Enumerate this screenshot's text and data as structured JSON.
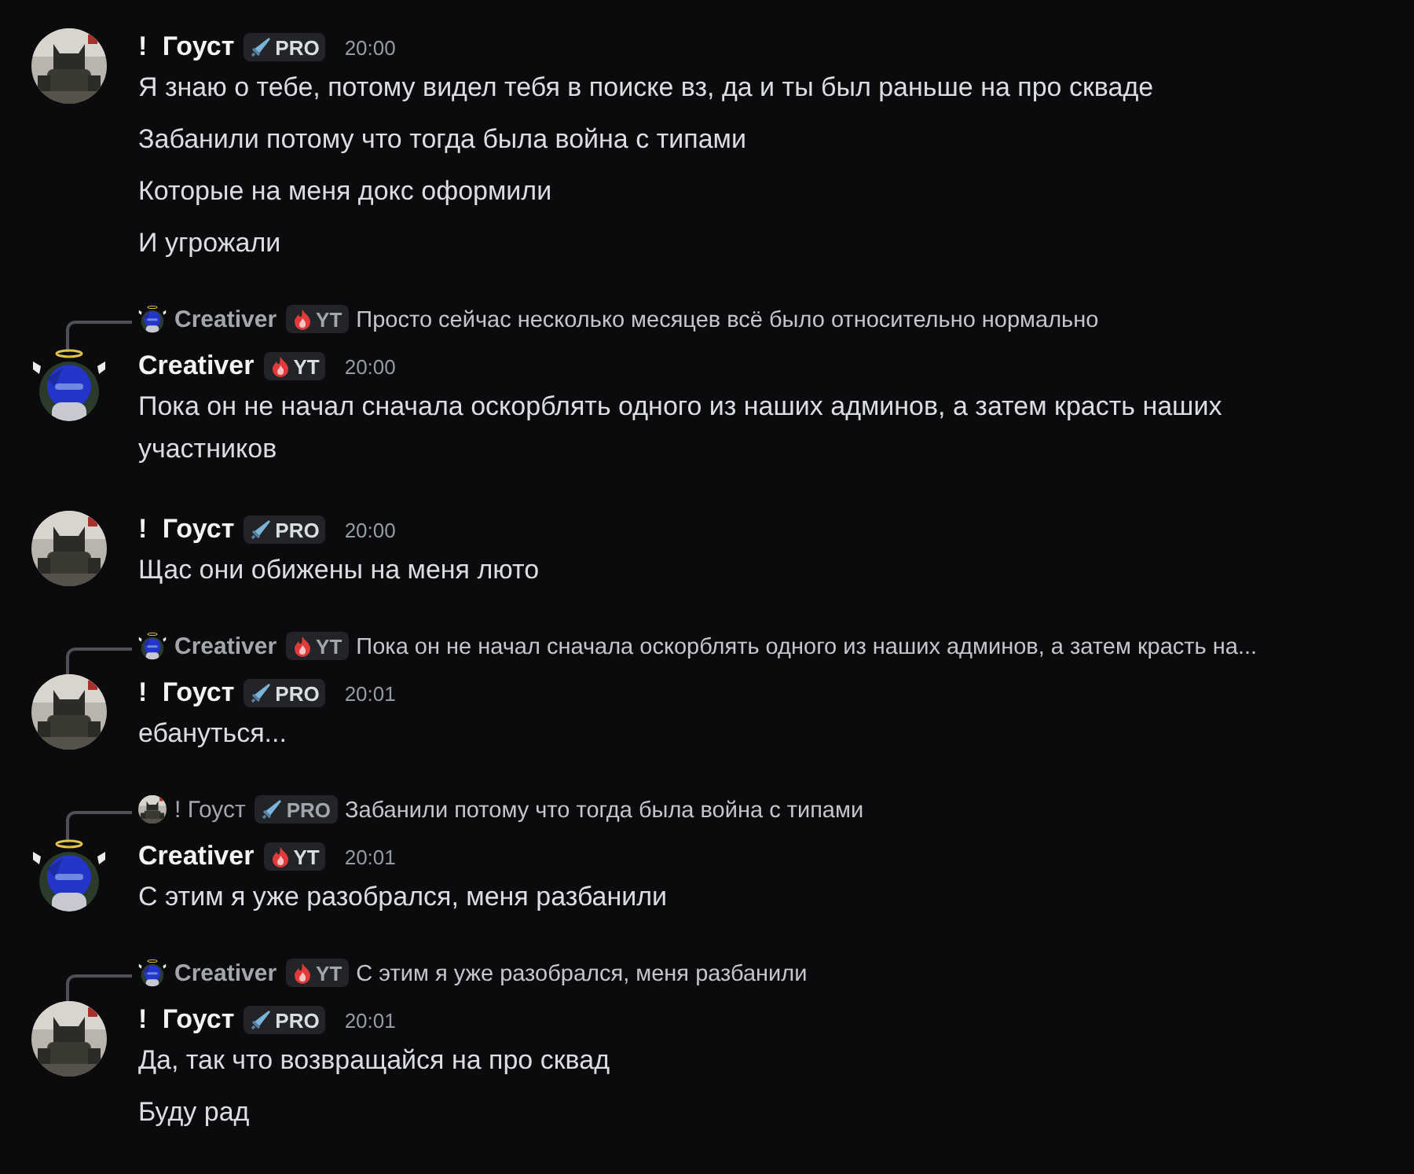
{
  "messages": [
    {
      "author": "! Гоуст",
      "avatar": {
        "kind": "dark"
      },
      "badge": {
        "kind": "sword",
        "label": "PRO"
      },
      "time": "20:00",
      "lines": [
        "Я знаю о тебе, потому видел тебя в поиске вз, да и ты был раньше на про скваде",
        "Забанили потому что тогда была война с типами",
        "Которые на меня докс оформили",
        "И угрожали"
      ]
    },
    {
      "reply": {
        "author": "Creativer",
        "avatar": {
          "kind": "blue"
        },
        "badge": {
          "kind": "flame",
          "label": "YT"
        },
        "text": "Просто сейчас несколько месяцев всё было относительно нормально"
      },
      "author": "Creativer",
      "avatar": {
        "kind": "blue"
      },
      "badge": {
        "kind": "flame",
        "label": "YT"
      },
      "time": "20:00",
      "lines": [
        "Пока он не начал сначала оскорблять одного из наших админов, а затем красть наших участников"
      ]
    },
    {
      "author": "! Гоуст",
      "avatar": {
        "kind": "dark"
      },
      "badge": {
        "kind": "sword",
        "label": "PRO"
      },
      "time": "20:00",
      "lines": [
        "Щас они обижены на меня люто"
      ]
    },
    {
      "reply": {
        "author": "Creativer",
        "avatar": {
          "kind": "blue"
        },
        "badge": {
          "kind": "flame",
          "label": "YT"
        },
        "text": "Пока он не начал сначала оскорблять одного из наших админов, а затем красть на..."
      },
      "author": "! Гоуст",
      "avatar": {
        "kind": "dark"
      },
      "badge": {
        "kind": "sword",
        "label": "PRO"
      },
      "time": "20:01",
      "lines": [
        "ебануться..."
      ]
    },
    {
      "reply": {
        "author": "! Гоуст",
        "avatar": {
          "kind": "dark"
        },
        "badge": {
          "kind": "sword",
          "label": "PRO"
        },
        "text": "Забанили потому что тогда была война с типами"
      },
      "author": "Creativer",
      "avatar": {
        "kind": "blue"
      },
      "badge": {
        "kind": "flame",
        "label": "YT"
      },
      "time": "20:01",
      "lines": [
        "С этим я уже разобрался, меня разбанили"
      ]
    },
    {
      "reply": {
        "author": "Creativer",
        "avatar": {
          "kind": "blue"
        },
        "badge": {
          "kind": "flame",
          "label": "YT"
        },
        "text": "С этим я уже разобрался, меня разбанили"
      },
      "author": "! Гоуст",
      "avatar": {
        "kind": "dark"
      },
      "badge": {
        "kind": "sword",
        "label": "PRO"
      },
      "time": "20:01",
      "lines": [
        "Да, так что возвращайся на про сквад",
        "Буду рад"
      ]
    }
  ]
}
